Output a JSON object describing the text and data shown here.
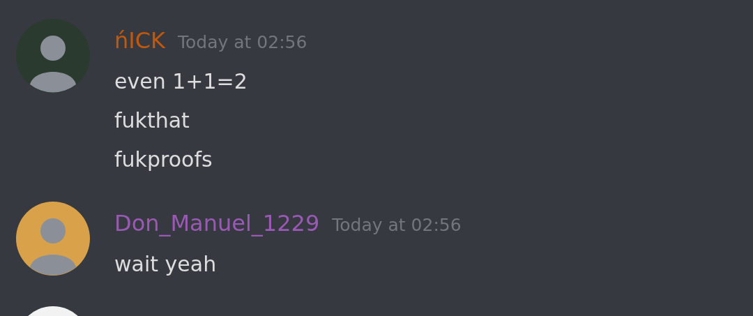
{
  "messages": [
    {
      "author": "ńICK",
      "color": "#c0590f",
      "timestamp": "Today at 02:56",
      "lines": [
        "even 1+1=2",
        "fukthat",
        "fukproofs"
      ],
      "avatar": {
        "color": "#2b3a2e"
      }
    },
    {
      "author": "Don_Manuel_1229",
      "color": "#9b59b6",
      "timestamp": "Today at 02:56",
      "lines": [
        "wait yeah"
      ],
      "avatar": {
        "color": "#d9a24a"
      }
    },
    {
      "avatar": {
        "color": "#f2f2f2"
      }
    }
  ]
}
